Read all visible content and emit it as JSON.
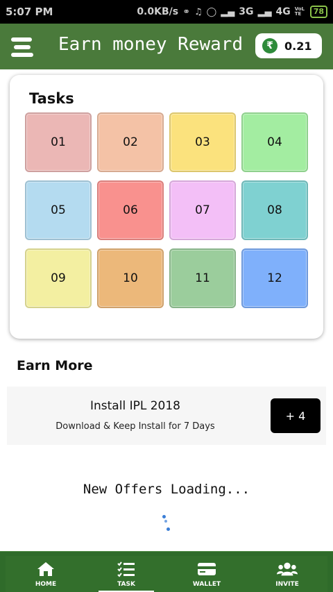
{
  "status_bar": {
    "time": "5:07 PM",
    "network_speed": "0.0KB/s",
    "network_3g": "3G",
    "network_4g": "4G",
    "volte": "VoLTE",
    "battery": "78"
  },
  "header": {
    "title": "Earn money Reward",
    "balance": "0.21",
    "currency_icon": "rupee-icon",
    "menu_icon": "menu-icon"
  },
  "tasks": {
    "title": "Tasks",
    "items": [
      {
        "label": "01",
        "color": "#ebb7b5"
      },
      {
        "label": "02",
        "color": "#f4c2a6"
      },
      {
        "label": "03",
        "color": "#fbe27d"
      },
      {
        "label": "04",
        "color": "#a3eda1"
      },
      {
        "label": "05",
        "color": "#b4dbf0"
      },
      {
        "label": "06",
        "color": "#f9918e"
      },
      {
        "label": "07",
        "color": "#f3bff7"
      },
      {
        "label": "08",
        "color": "#7fd1d1"
      },
      {
        "label": "09",
        "color": "#f3efa1"
      },
      {
        "label": "10",
        "color": "#ecb87a"
      },
      {
        "label": "11",
        "color": "#9bcd9c"
      },
      {
        "label": "12",
        "color": "#7fb0fb"
      }
    ]
  },
  "earn_more": {
    "title": "Earn More",
    "offers": [
      {
        "name": "Install IPL 2018",
        "description": "Download & Keep Install for 7 Days",
        "reward": "+ 4"
      }
    ]
  },
  "loading": {
    "text": "New Offers Loading..."
  },
  "bottom_nav": {
    "items": [
      {
        "label": "HOME",
        "icon": "home-icon"
      },
      {
        "label": "TASK",
        "icon": "task-list-icon"
      },
      {
        "label": "WALLET",
        "icon": "wallet-icon"
      },
      {
        "label": "INVITE",
        "icon": "invite-icon"
      }
    ],
    "active": "TASK"
  },
  "colors": {
    "header": "#4a7a3b",
    "nav": "#2f6b2a",
    "rupee": "#2e8b3a",
    "spinner": "#3b7ed6"
  }
}
